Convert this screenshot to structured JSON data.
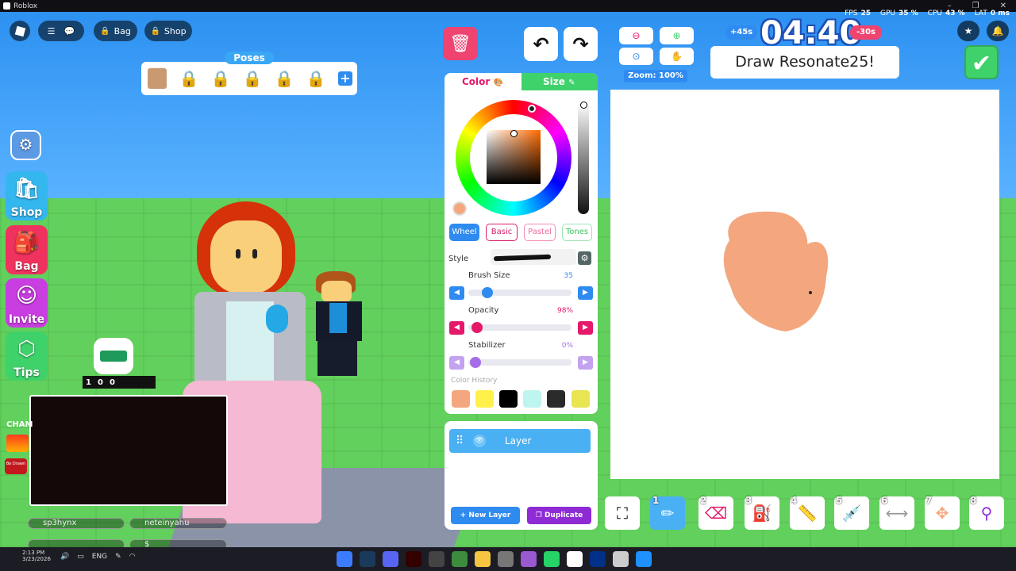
{
  "window": {
    "title": "Roblox"
  },
  "perf": {
    "fps_label": "FPS",
    "fps": "25",
    "gpu_label": "GPU",
    "gpu": "35 %",
    "cpu_label": "CPU",
    "cpu": "43 %",
    "lat_label": "LAT",
    "lat": "0 ms"
  },
  "topbar": {
    "bag_label": "Bag",
    "shop_label": "Shop"
  },
  "poses": {
    "title": "Poses"
  },
  "side": {
    "shop": "Shop",
    "bag": "Bag",
    "invite": "Invite",
    "tips": "Tips"
  },
  "stream": {
    "p": "1",
    "k": "0",
    "y": "0"
  },
  "overlay": {
    "cham": "CHAM",
    "be_drawn": "Be Drawn"
  },
  "users": [
    "sp3hynx",
    "neteinyahu",
    "",
    "$"
  ],
  "panel": {
    "tab_color": "Color",
    "tab_size": "Size",
    "modes": [
      "Wheel",
      "Basic",
      "Pastel",
      "Tones"
    ],
    "style_label": "Style",
    "brush_size_label": "Brush Size",
    "brush_size": "35",
    "opacity_label": "Opacity",
    "opacity": "98%",
    "stabilizer_label": "Stabilizer",
    "stabilizer": "0%",
    "history_label": "Color History",
    "history_colors": [
      "#f4a77e",
      "#fff04a",
      "#000000",
      "#bff5f0",
      "#2a2a2a",
      "#e8e452"
    ],
    "current_color": "#f4a77e"
  },
  "layers": {
    "layer_name": "Layer",
    "new_layer": "New Layer",
    "duplicate": "Duplicate"
  },
  "zoom": {
    "label": "Zoom:",
    "value": "100%"
  },
  "timer": {
    "plus": "+45s",
    "time": "04:40",
    "minus": "-30s"
  },
  "prompt": {
    "text": "Draw Resonate25!"
  },
  "tools": [
    "1",
    "2",
    "3",
    "4",
    "5",
    "6",
    "7",
    "8"
  ],
  "taskbar": {
    "time": "2:13 PM",
    "date": "3/23/2026",
    "lang": "ENG"
  }
}
